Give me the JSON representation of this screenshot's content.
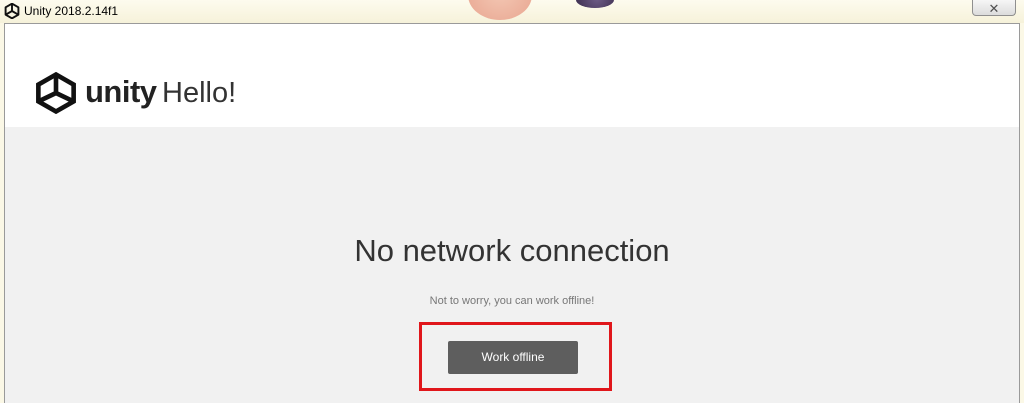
{
  "window": {
    "title": "Unity 2018.2.14f1",
    "close_icon": "close-icon",
    "title_icon": "unity-logo-icon"
  },
  "header": {
    "logo_icon": "unity-logo-icon",
    "wordmark": "unity",
    "greeting": "Hello!"
  },
  "main": {
    "heading": "No network connection",
    "subtext": "Not to worry, you can work offline!",
    "work_offline_label": "Work offline"
  },
  "colors": {
    "button_bg": "#5e5e5e",
    "button_text": "#ffffff",
    "highlight_border": "#e0161b",
    "content_bg": "#f1f1f1",
    "header_bg": "#ffffff"
  }
}
